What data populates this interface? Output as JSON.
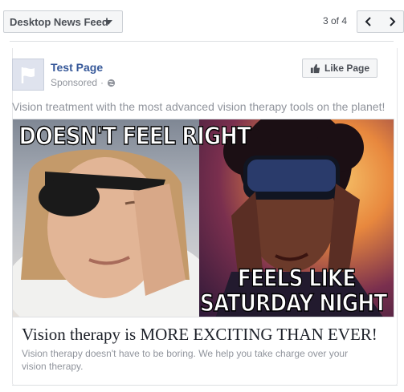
{
  "topbar": {
    "placement_label": "Desktop News Feed",
    "pager_text": "3 of 4"
  },
  "post": {
    "page_name": "Test Page",
    "sponsored_label": "Sponsored",
    "separator": "·",
    "like_button_label": "Like Page",
    "text": "Vision treatment with the most advanced vision therapy tools on the planet!",
    "image": {
      "top_caption": "DOESN'T FEEL RIGHT",
      "bottom_caption_line1": "FEELS LIKE",
      "bottom_caption_line2": "SATURDAY NIGHT"
    },
    "headline": "Vision therapy is MORE EXCITING THAN EVER!",
    "description": "Vision therapy doesn't have to be boring. We help you take charge over your vision therapy."
  },
  "colors": {
    "link_blue": "#365899",
    "muted_text": "#90949c",
    "button_bg": "#f5f6f7",
    "border": "#ccd0d5"
  },
  "icons": {
    "dropdown": "caret-down-icon",
    "prev": "chevron-left-icon",
    "next": "chevron-right-icon",
    "privacy": "globe-icon",
    "like": "thumbs-up-icon",
    "avatar": "flag-icon"
  }
}
